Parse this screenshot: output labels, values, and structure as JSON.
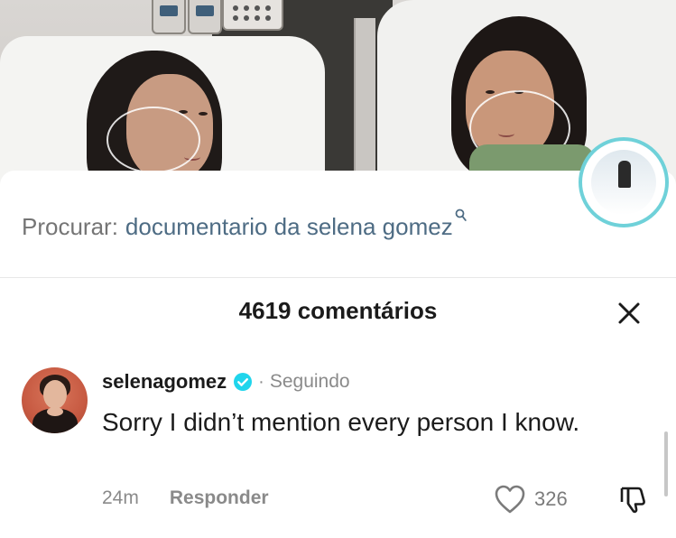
{
  "search": {
    "prefix": "Procurar:",
    "query": "documentario da selena gomez",
    "icon": "search-icon"
  },
  "comments_panel": {
    "count_label": "4619 comentários",
    "close_icon": "close-icon"
  },
  "comment": {
    "username": "selenagomez",
    "verified_icon": "verified-icon",
    "separator": "·",
    "follow_status": "Seguindo",
    "text": "Sorry I didn’t mention every person I know.",
    "time": "24m",
    "reply_label": "Responder",
    "likes": "326",
    "like_icon": "heart-icon",
    "dislike_icon": "thumbs-down-icon"
  },
  "colors": {
    "verified": "#20d5ec",
    "search_query": "#4e6c84",
    "text": "#1b1b1b",
    "muted": "#8a8a8a"
  }
}
